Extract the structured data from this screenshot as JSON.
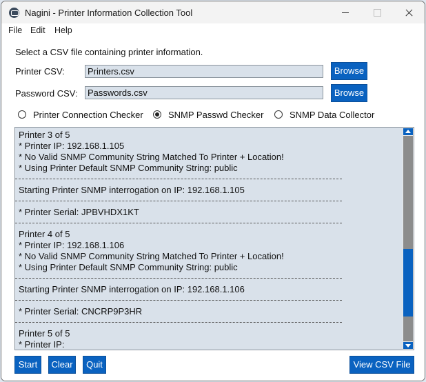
{
  "window": {
    "title": "Nagini - Printer Information Collection Tool"
  },
  "menu": {
    "file": "File",
    "edit": "Edit",
    "help": "Help"
  },
  "form": {
    "instruction": "Select a CSV file containing printer information.",
    "printer_csv_label": "Printer CSV:",
    "printer_csv_value": "Printers.csv",
    "password_csv_label": "Password CSV:",
    "password_csv_value": "Passwords.csv",
    "browse_label": "Browse"
  },
  "modes": {
    "selected": "SNMP Passwd Checker",
    "options": [
      "Printer Connection Checker",
      "SNMP Passwd Checker",
      "SNMP Data Collector"
    ]
  },
  "log": {
    "lines": [
      "Printer 3 of 5",
      "* Printer IP: 192.168.1.105",
      "* No Valid SNMP Community String Matched To Printer + Location!",
      "* Using Printer Default SNMP Community String: public",
      "Starting Printer SNMP interrogation on IP: 192.168.1.105",
      "* Printer Serial: JPBVHDX1KT",
      "Printer 4 of 5",
      "* Printer IP: 192.168.1.106",
      "* No Valid SNMP Community String Matched To Printer + Location!",
      "* Using Printer Default SNMP Community String: public",
      "Starting Printer SNMP interrogation on IP: 192.168.1.106",
      "* Printer Serial: CNCRP9P3HR",
      "Printer 5 of 5",
      "* Printer IP:"
    ],
    "scroll_position": 0.66
  },
  "actions": {
    "start": "Start",
    "clear": "Clear",
    "quit": "Quit",
    "view_csv": "View CSV File"
  },
  "colors": {
    "accent": "#0a62c0",
    "field_bg": "#d9e1ea",
    "scroll_track": "#8c8c8c"
  }
}
